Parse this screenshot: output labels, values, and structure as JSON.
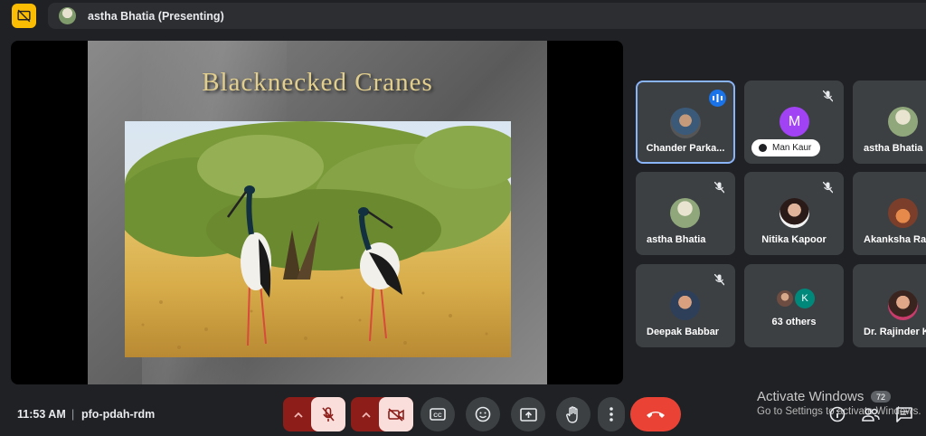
{
  "header": {
    "presenter_label": "astha Bhatia (Presenting)"
  },
  "slide": {
    "title": "Blacknecked Cranes"
  },
  "participants": [
    {
      "name": "Chander Parka...",
      "state": "speaking"
    },
    {
      "name": "Man Kaur",
      "avatar_letter": "M",
      "state": "muted"
    },
    {
      "name": "astha Bhatia"
    },
    {
      "name": "astha Bhatia",
      "state": "muted"
    },
    {
      "name": "Nitika Kapoor",
      "state": "muted"
    },
    {
      "name": "Akanksha Ran"
    },
    {
      "name": "Deepak Babbar",
      "state": "muted"
    },
    {
      "name": "63 others",
      "avatar_letter": "K"
    },
    {
      "name": "Dr. Rajinder K"
    }
  ],
  "footer": {
    "time": "11:53 AM",
    "separator": "|",
    "meeting_code": "pfo-pdah-rdm",
    "participant_count": "72"
  },
  "watermark": {
    "title": "Activate Windows",
    "subtitle": "Go to Settings to activate Windows."
  },
  "colors": {
    "background": "#202124",
    "tile": "#3c4043",
    "accent_blue": "#1a73e8",
    "end_call_red": "#ea4335",
    "presenting_yellow": "#fbbc04"
  }
}
